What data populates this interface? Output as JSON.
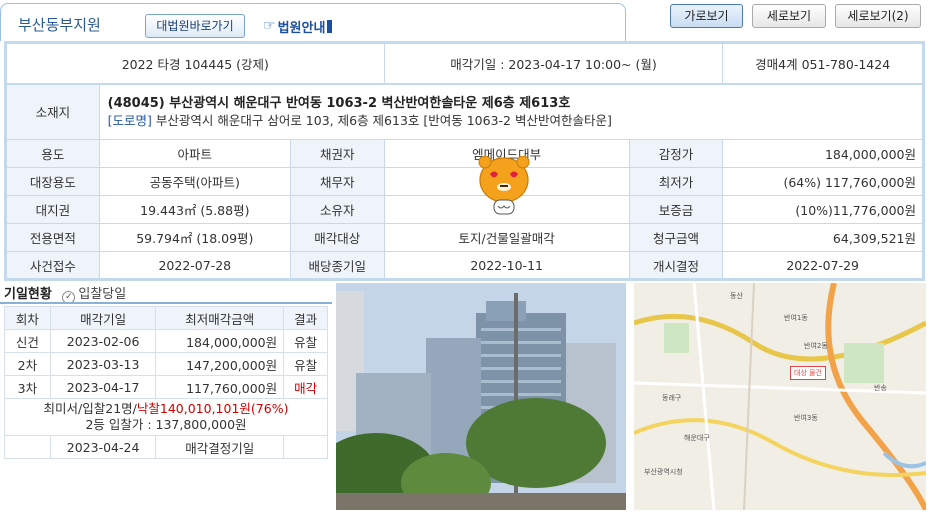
{
  "header": {
    "court_name": "부산동부지원",
    "court_site_button": "대법원바로가기",
    "court_logo_text": "법원안내",
    "views": [
      "가로보기",
      "세로보기",
      "세로보기(2)"
    ]
  },
  "case": {
    "number": "2022 타경 104445 (강제)",
    "sale_date": "매각기일 : 2023-04-17 10:00~ (월)",
    "department": "경매4계 051-780-1424"
  },
  "location": {
    "label": "소재지",
    "address_main": "(48045) 부산광역시 해운대구 반여동 1063-2 벽산반여한솔타운 제6층 제613호",
    "road_tag": "[도로명]",
    "address_road": "부산광역시 해운대구 삼어로 103, 제6층 제613호 [반여동 1063-2 벽산반여한솔타운]"
  },
  "details": [
    {
      "l1": "용도",
      "v1": "아파트",
      "l2": "채권자",
      "v2": "엠메이드대부",
      "l3": "감정가",
      "v3": "184,000,000원"
    },
    {
      "l1": "대장용도",
      "v1": "공동주택(아파트)",
      "l2": "채무자",
      "v2": "",
      "l3": "최저가",
      "v3": "(64%) 117,760,000원"
    },
    {
      "l1": "대지권",
      "v1": "19.443㎡ (5.88평)",
      "l2": "소유자",
      "v2": "",
      "l3": "보증금",
      "v3": "(10%)11,776,000원"
    },
    {
      "l1": "전용면적",
      "v1": "59.794㎡ (18.09평)",
      "l2": "매각대상",
      "v2": "토지/건물일괄매각",
      "l3": "청구금액",
      "v3": "64,309,521원"
    },
    {
      "l1": "사건접수",
      "v1": "2022-07-28",
      "l2": "배당종기일",
      "v2": "2022-10-11",
      "l3": "개시결정",
      "v3": "2022-07-29"
    }
  ],
  "bids": {
    "title": "기일현황",
    "subtitle": "입찰당일",
    "headers": [
      "회차",
      "매각기일",
      "최저매각금액",
      "결과"
    ],
    "rows": [
      {
        "round": "신건",
        "date": "2023-02-06",
        "amount": "184,000,000원",
        "result": "유찰"
      },
      {
        "round": "2차",
        "date": "2023-03-13",
        "amount": "147,200,000원",
        "result": "유찰"
      },
      {
        "round": "3차",
        "date": "2023-04-17",
        "amount": "117,760,000원",
        "result": "매각"
      }
    ],
    "summary_prefix": "최미서/입찰21명/",
    "summary_red": "낙찰140,010,101원(76%)",
    "second_bid": "2등 입찰가 : 137,800,000원",
    "final_date": "2023-04-24",
    "final_label": "매각결정기일"
  },
  "map": {
    "labels": [
      "동산",
      "반여1동",
      "반여2동",
      "반여3동",
      "해운대구",
      "부산광역시청",
      "대상 물건",
      "동래구",
      "반송"
    ]
  }
}
